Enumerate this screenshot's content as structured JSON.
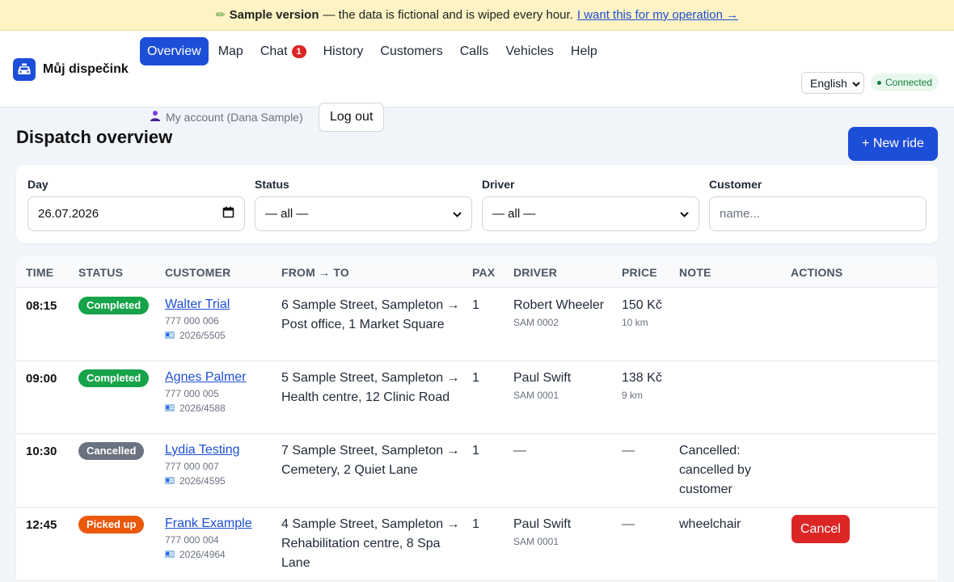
{
  "banner": {
    "label": "Sample version",
    "text": "— the data is fictional and is wiped every hour.",
    "link": "I want this for my operation →"
  },
  "brand": {
    "name": "Můj dispečink"
  },
  "nav": {
    "items": [
      "Overview",
      "Map",
      "Chat",
      "History",
      "Customers",
      "Calls",
      "Vehicles",
      "Help"
    ],
    "chat_badge": "1",
    "account": "My account (Dana Sample)",
    "logout": "Log out"
  },
  "header_right": {
    "language": "English",
    "connection": "Connected"
  },
  "page": {
    "title": "Dispatch overview",
    "new_ride": "+ New ride"
  },
  "filters": {
    "day_label": "Day",
    "day_value": "26.07.2026",
    "status_label": "Status",
    "status_value": "— all —",
    "driver_label": "Driver",
    "driver_value": "— all —",
    "customer_label": "Customer",
    "customer_placeholder": "name..."
  },
  "table": {
    "headers": [
      "TIME",
      "STATUS",
      "CUSTOMER",
      "FROM → TO",
      "PAX",
      "DRIVER",
      "PRICE",
      "NOTE",
      "ACTIONS"
    ],
    "rows": [
      {
        "time": "08:15",
        "status": "Completed",
        "customer": "Walter Trial",
        "phone": "777 000 006",
        "card": "2026/5505",
        "route": "6 Sample Street, Sampleton → Post office, 1 Market Square",
        "pax": "1",
        "driver": "Robert Wheeler",
        "vehicle": "SAM 0002",
        "price": "150 Kč",
        "distance": "10 km",
        "note": "",
        "action": ""
      },
      {
        "time": "09:00",
        "status": "Completed",
        "customer": "Agnes Palmer",
        "phone": "777 000 005",
        "card": "2026/4588",
        "route": "5 Sample Street, Sampleton → Health centre, 12 Clinic Road",
        "pax": "1",
        "driver": "Paul Swift",
        "vehicle": "SAM 0001",
        "price": "138 Kč",
        "distance": "9 km",
        "note": "",
        "action": ""
      },
      {
        "time": "10:30",
        "status": "Cancelled",
        "customer": "Lydia Testing",
        "phone": "777 000 007",
        "card": "2026/4595",
        "route": "7 Sample Street, Sampleton → Cemetery, 2 Quiet Lane",
        "pax": "1",
        "driver": "—",
        "vehicle": "",
        "price": "—",
        "distance": "",
        "note": "Cancelled: cancelled by customer",
        "action": ""
      },
      {
        "time": "12:45",
        "status": "Picked up",
        "customer": "Frank Example",
        "phone": "777 000 004",
        "card": "2026/4964",
        "route": "4 Sample Street, Sampleton → Rehabilitation centre, 8 Spa Lane",
        "pax": "1",
        "driver": "Paul Swift",
        "vehicle": "SAM 0001",
        "price": "—",
        "distance": "",
        "note": "wheelchair",
        "action": "Cancel"
      }
    ]
  },
  "colors": {
    "accent": "#1d4ed8",
    "completed": "#16a34a",
    "cancelled": "#6b7280",
    "picked_up": "#ea580c",
    "danger": "#dc2626",
    "banner_bg": "#fdf3c4"
  },
  "icons": {
    "brand": "taxi-icon",
    "banner": "pencil-icon",
    "account": "user-icon",
    "card": "id-card-icon",
    "calendar": "calendar-icon",
    "select": "chevron-down-icon"
  }
}
